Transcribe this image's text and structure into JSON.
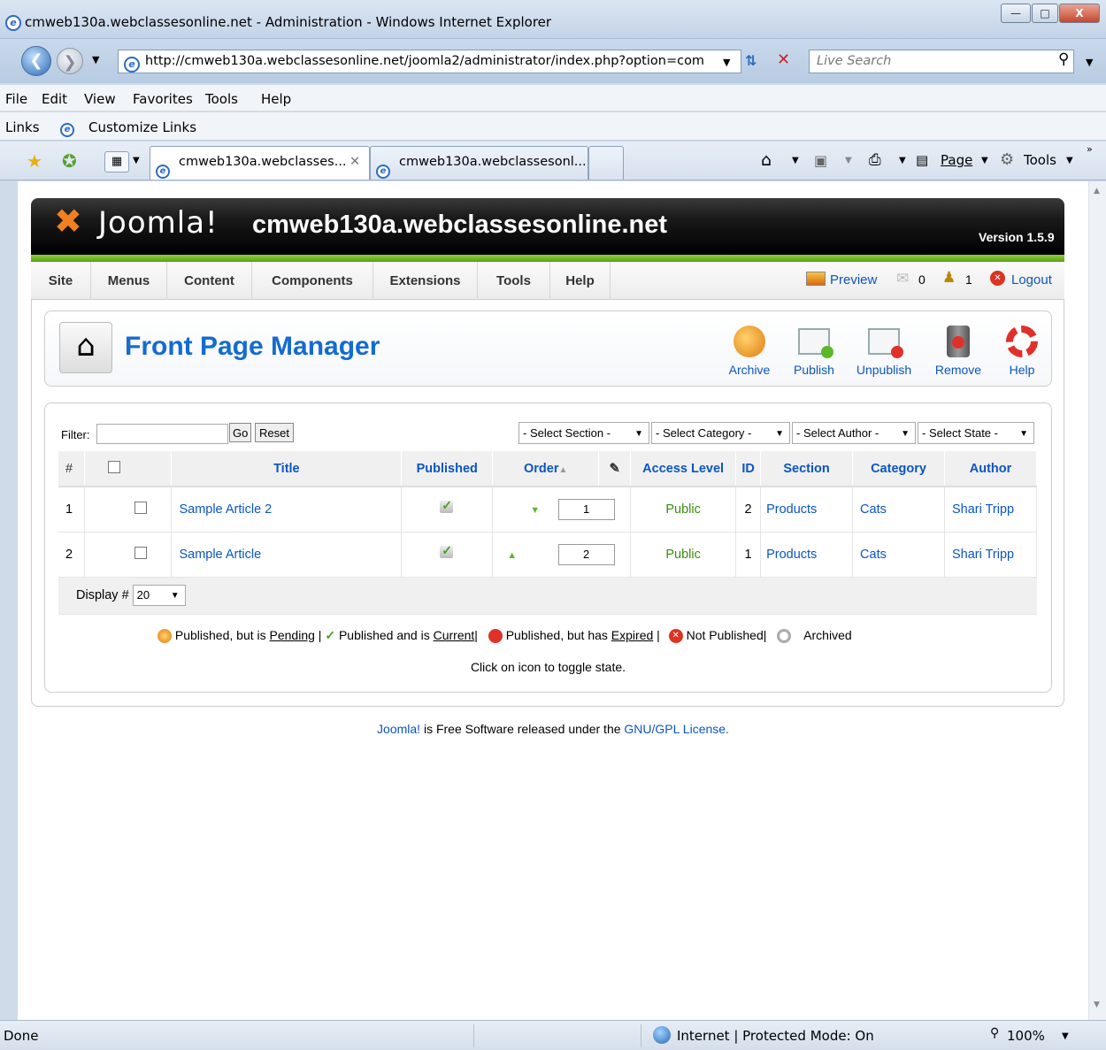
{
  "browser": {
    "window_title": "cmweb130a.webclassesonline.net - Administration - Windows Internet Explorer",
    "url": "http://cmweb130a.webclassesonline.net/joomla2/administrator/index.php?option=com",
    "search_placeholder": "Live Search",
    "menu": [
      "File",
      "Edit",
      "View",
      "Favorites",
      "Tools",
      "Help"
    ],
    "links_label": "Links",
    "customize_links": "Customize Links",
    "tabs": [
      "cmweb130a.webclasses...",
      "cmweb130a.webclassesonl..."
    ],
    "cmd_page": "Page",
    "cmd_tools": "Tools",
    "status_text": "Done",
    "zone": "Internet | Protected Mode: On",
    "zoom": "100%"
  },
  "joomla": {
    "logo": "Joomla!",
    "site_name": "cmweb130a.webclassesonline.net",
    "version": "Version 1.5.9",
    "nav": [
      "Site",
      "Menus",
      "Content",
      "Components",
      "Extensions",
      "Tools",
      "Help"
    ],
    "preview": "Preview",
    "messages_count": "0",
    "users_count": "1",
    "logout": "Logout",
    "page_title": "Front Page Manager",
    "toolbar": {
      "archive": "Archive",
      "publish": "Publish",
      "unpublish": "Unpublish",
      "remove": "Remove",
      "help": "Help"
    },
    "filter_label": "Filter:",
    "filter_value": "",
    "go": "Go",
    "reset": "Reset",
    "selects": [
      "- Select Section -",
      "- Select Category -",
      "- Select Author -",
      "- Select State -"
    ],
    "columns": {
      "num": "#",
      "title": "Title",
      "published": "Published",
      "order": "Order",
      "access": "Access Level",
      "id": "ID",
      "section": "Section",
      "category": "Category",
      "author": "Author"
    },
    "rows": [
      {
        "num": "1",
        "title": "Sample Article 2",
        "order": "1",
        "access": "Public",
        "id": "2",
        "section": "Products",
        "category": "Cats",
        "author": "Shari Tripp"
      },
      {
        "num": "2",
        "title": "Sample Article",
        "order": "2",
        "access": "Public",
        "id": "1",
        "section": "Products",
        "category": "Cats",
        "author": "Shari Tripp"
      }
    ],
    "display_label": "Display #",
    "display_value": "20",
    "legend": {
      "pending_pre": "Published, but is ",
      "pending": "Pending",
      "current_pre": "Published and is ",
      "current": "Current",
      "expired_pre": "Published, but has ",
      "expired": "Expired",
      "not_published": "Not Published",
      "archived": "Archived",
      "sep": "|"
    },
    "toggle_note": "Click on icon to toggle state.",
    "footer_link": "Joomla!",
    "footer_text": "is Free Software released under the",
    "footer_license": "GNU/GPL License."
  }
}
